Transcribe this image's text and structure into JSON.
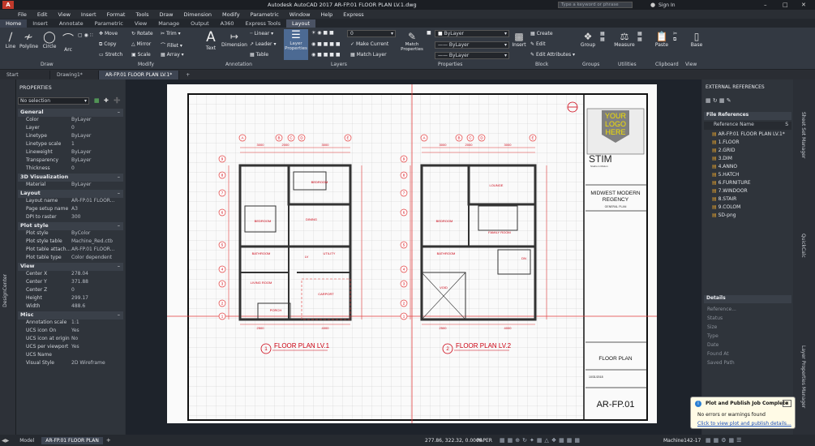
{
  "window": {
    "title": "Autodesk AutoCAD 2017    AR-FP.01 FLOOR PLAN LV.1.dwg",
    "search_placeholder": "Type a keyword or phrase",
    "sign_in": "Sign In"
  },
  "menu": [
    "File",
    "Edit",
    "View",
    "Insert",
    "Format",
    "Tools",
    "Draw",
    "Dimension",
    "Modify",
    "Parametric",
    "Window",
    "Help",
    "Express"
  ],
  "ribbon_tabs": [
    "Home",
    "Insert",
    "Annotate",
    "Parametric",
    "View",
    "Manage",
    "Output",
    "A360",
    "Express Tools",
    "Layout"
  ],
  "ribbon": {
    "draw": {
      "line": "Line",
      "polyline": "Polyline",
      "circle": "Circle",
      "arc": "Arc"
    },
    "modify": {
      "move": "Move",
      "rotate": "Rotate",
      "trim": "Trim",
      "copy": "Copy",
      "mirror": "Mirror",
      "fillet": "Fillet",
      "stretch": "Stretch",
      "scale": "Scale",
      "array": "Array"
    },
    "annotation": {
      "text": "Text",
      "dimension": "Dimension",
      "linear": "Linear",
      "leader": "Leader",
      "table": "Table"
    },
    "layers": {
      "layer_properties": "Layer Properties",
      "make_current": "Make Current",
      "match_layer": "Match Layer",
      "layer_value": "0"
    },
    "properties": {
      "match_properties": "Match Properties",
      "bylayer1": "ByLayer",
      "bylayer2": "ByLayer",
      "bylayer3": "ByLayer"
    },
    "block": {
      "insert": "Insert",
      "create": "Create",
      "edit": "Edit",
      "edit_attributes": "Edit Attributes"
    },
    "group": "Group",
    "measure": "Measure",
    "paste": "Paste",
    "base": "Base",
    "panel_labels": [
      "Draw",
      "Modify",
      "Annotation",
      "Layers",
      "Properties",
      "Block",
      "Groups",
      "Utilities",
      "Clipboard",
      "View"
    ]
  },
  "doc_tabs": [
    "Start",
    "Drawing1*",
    "AR-FP.01 FLOOR PLAN LV.1*"
  ],
  "left_palette_label": "DesignCenter",
  "properties_panel": {
    "title": "PROPERTIES",
    "selection": "No selection",
    "sections": [
      {
        "name": "General",
        "rows": [
          [
            "Color",
            "ByLayer"
          ],
          [
            "Layer",
            "0"
          ],
          [
            "Linetype",
            "ByLayer"
          ],
          [
            "Linetype scale",
            "1"
          ],
          [
            "Lineweight",
            "ByLayer"
          ],
          [
            "Transparency",
            "ByLayer"
          ],
          [
            "Thickness",
            "0"
          ]
        ]
      },
      {
        "name": "3D Visualization",
        "rows": [
          [
            "Material",
            "ByLayer"
          ]
        ]
      },
      {
        "name": "Layout",
        "rows": [
          [
            "Layout name",
            "AR-FP.01 FLOOR..."
          ],
          [
            "Page setup name",
            "A3"
          ],
          [
            "DPI to raster",
            "300"
          ]
        ]
      },
      {
        "name": "Plot style",
        "rows": [
          [
            "Plot style",
            "ByColor"
          ],
          [
            "Plot style table",
            "Machine_Red.ctb"
          ],
          [
            "Plot table attach...",
            "AR-FP.01 FLOOR..."
          ],
          [
            "Plot table type",
            "Color dependent"
          ]
        ]
      },
      {
        "name": "View",
        "rows": [
          [
            "Center X",
            "278.04"
          ],
          [
            "Center Y",
            "371.88"
          ],
          [
            "Center Z",
            "0"
          ],
          [
            "Height",
            "299.17"
          ],
          [
            "Width",
            "488.6"
          ]
        ]
      },
      {
        "name": "Misc",
        "rows": [
          [
            "Annotation scale",
            "1:1"
          ],
          [
            "UCS icon On",
            "Yes"
          ],
          [
            "UCS icon at origin",
            "No"
          ],
          [
            "UCS per viewport",
            "Yes"
          ],
          [
            "UCS Name",
            ""
          ],
          [
            "Visual Style",
            "2D Wireframe"
          ]
        ]
      }
    ]
  },
  "drawing": {
    "logo_text": "YOUR LOGO HERE",
    "company": "STIM",
    "company_sub": "Studio in Motion",
    "project": "MIDWEST MODERN REGENCY",
    "project_sub": "GENERAL PLAN",
    "sheet_title": "FLOOR PLAN",
    "sheet_no": "AR-FP.01",
    "date": "10/31/2018",
    "plan1_title": "FLOOR PLAN LV.1",
    "plan2_title": "FLOOR PLAN LV.2",
    "plan1_num": "1",
    "plan2_num": "2",
    "grid_cols1": [
      "A",
      "B",
      "C",
      "D",
      "E"
    ],
    "grid_cols2": [
      "A",
      "B",
      "C",
      "D",
      "E"
    ],
    "grid_rows": [
      "9",
      "8",
      "7",
      "6",
      "5",
      "4",
      "3",
      "2",
      "1"
    ],
    "rooms1": [
      "BEDROOM",
      "BEDROOM",
      "DINING",
      "BATHROOM",
      "UTILITY",
      "LIVING ROOM",
      "CARPORT",
      "PORCH",
      "LV"
    ],
    "rooms2": [
      "LOUNGE",
      "BEDROOM",
      "FAMILY ROOM",
      "BATHROOM",
      "VOID",
      "DN"
    ],
    "dims": [
      "3000",
      "2000",
      "3000",
      "1500",
      "4000",
      "2500"
    ]
  },
  "xref_panel": {
    "title": "EXTERNAL REFERENCES",
    "file_refs": "File References",
    "col": "Reference Name",
    "col2": "S",
    "items": [
      "AR-FP.01 FLOOR PLAN LV.1*",
      "1.FLOOR",
      "2.GRID",
      "3.DIM",
      "4.ANNO",
      "5.HATCH",
      "6.FURNITURE",
      "7.WINDOOR",
      "8.STAIR",
      "9.COLOM",
      "SD-png"
    ],
    "details": "Details",
    "detail_rows": [
      "Reference...",
      "Status",
      "Size",
      "Type",
      "Date",
      "Found At",
      "Saved Path"
    ]
  },
  "right_tabs": [
    "Sheet Set Manager",
    "QuickCalc",
    "Layer Properties Manager"
  ],
  "notification": {
    "title": "Plot and Publish Job Complete",
    "line": "No errors or warnings found",
    "link": "Click to view plot and publish details..."
  },
  "status": {
    "tab_model": "Model",
    "tab_layout": "AR-FP.01 FLOOR PLAN",
    "coords": "277.86, 322.32, 0.0000",
    "paper": "PAPER",
    "machine": "Machine142-17"
  }
}
